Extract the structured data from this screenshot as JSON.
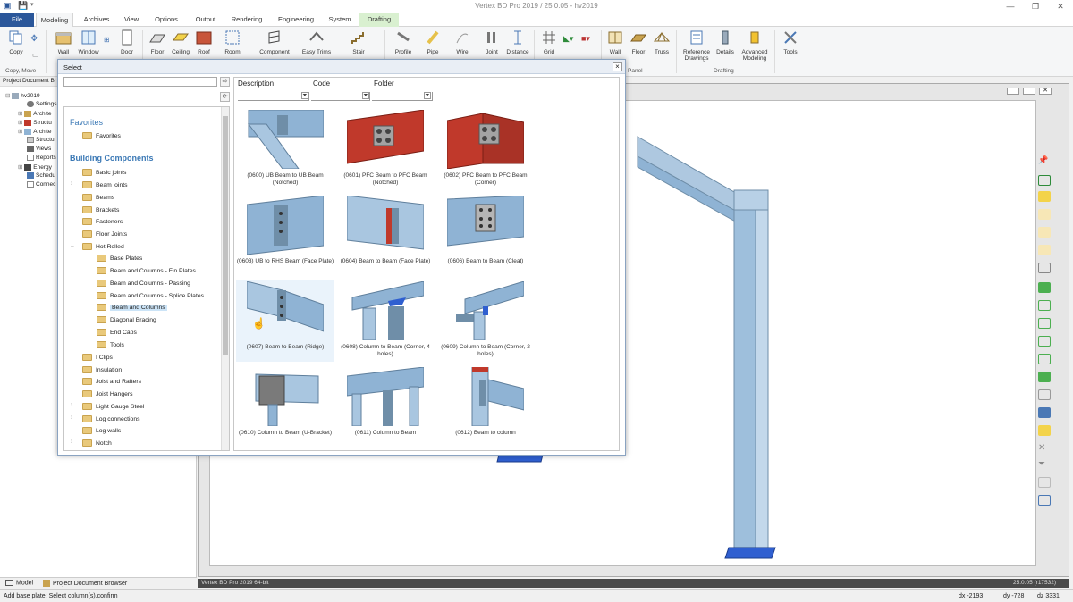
{
  "window": {
    "title": "Vertex BD Pro 2019 / 25.0.05 - hv2019"
  },
  "tabs": [
    {
      "label": "File"
    },
    {
      "label": "Modeling"
    },
    {
      "label": "Archives"
    },
    {
      "label": "View"
    },
    {
      "label": "Options"
    },
    {
      "label": "Output"
    },
    {
      "label": "Rendering"
    },
    {
      "label": "Engineering"
    },
    {
      "label": "System"
    },
    {
      "label": "Drafting"
    }
  ],
  "ribbon": {
    "buttons": [
      {
        "label": "Copy",
        "icon": "copy-icon"
      },
      {
        "label": "Wall",
        "icon": "wall-icon"
      },
      {
        "label": "Window",
        "icon": "window-icon"
      },
      {
        "label": "Door",
        "icon": "door-icon"
      },
      {
        "label": "Floor",
        "icon": "floor-icon"
      },
      {
        "label": "Ceiling",
        "icon": "ceiling-icon"
      },
      {
        "label": "Roof",
        "icon": "roof-icon"
      },
      {
        "label": "Room",
        "icon": "room-icon"
      },
      {
        "label": "Component",
        "icon": "component-icon"
      },
      {
        "label": "Easy Trims",
        "icon": "trim-icon"
      },
      {
        "label": "Stair",
        "icon": "stair-icon"
      },
      {
        "label": "Profile",
        "icon": "profile-icon"
      },
      {
        "label": "Pipe",
        "icon": "pipe-icon"
      },
      {
        "label": "Wire",
        "icon": "wire-icon"
      },
      {
        "label": "Joint",
        "icon": "joint-icon"
      },
      {
        "label": "Distance",
        "icon": "distance-icon"
      },
      {
        "label": "Grid",
        "icon": "grid-icon"
      },
      {
        "label": "Wall",
        "icon": "panel-wall-icon"
      },
      {
        "label": "Floor",
        "icon": "panel-floor-icon"
      },
      {
        "label": "Truss",
        "icon": "truss-icon"
      },
      {
        "label": "Reference Drawings",
        "icon": "reference-icon"
      },
      {
        "label": "Details",
        "icon": "details-icon"
      },
      {
        "label": "Advanced Modeling",
        "icon": "advanced-icon"
      },
      {
        "label": "Tools",
        "icon": "tools-icon"
      }
    ],
    "groups": {
      "copy_move": "Copy, Move",
      "panel": "Panel",
      "drafting": "Drafting"
    }
  },
  "left_panel": {
    "header": "Project Document Br",
    "tree": [
      {
        "label": "hv2019"
      },
      {
        "label": "Settings"
      },
      {
        "label": "Archite"
      },
      {
        "label": "Structu"
      },
      {
        "label": "Archite"
      },
      {
        "label": "Structu"
      },
      {
        "label": "Views"
      },
      {
        "label": "Reports"
      },
      {
        "label": "Energy"
      },
      {
        "label": "Schedu"
      },
      {
        "label": "Connec"
      }
    ],
    "bottom_tabs": [
      "Model",
      "Project Document Browser"
    ]
  },
  "dialog": {
    "title": "Select",
    "sections": {
      "favorites": "Favorites",
      "building_components": "Building Components"
    },
    "folders": [
      {
        "label": "Favorites"
      },
      {
        "label": "Basic joints"
      },
      {
        "label": "Beam joints"
      },
      {
        "label": "Beams"
      },
      {
        "label": "Brackets"
      },
      {
        "label": "Fasteners"
      },
      {
        "label": "Floor Joints"
      },
      {
        "label": "Hot Rolled"
      },
      {
        "label": "Base Plates"
      },
      {
        "label": "Beam and Columns - Fin Plates"
      },
      {
        "label": "Beam and Columns - Passing"
      },
      {
        "label": "Beam and Columns - Splice Plates"
      },
      {
        "label": "Beam and Columns"
      },
      {
        "label": "Diagonal Bracing"
      },
      {
        "label": "End Caps"
      },
      {
        "label": "Tools"
      },
      {
        "label": "I Clips"
      },
      {
        "label": "Insulation"
      },
      {
        "label": "Joist and Rafters"
      },
      {
        "label": "Joist Hangers"
      },
      {
        "label": "Light Gauge Steel"
      },
      {
        "label": "Log connections"
      },
      {
        "label": "Log walls"
      },
      {
        "label": "Notch"
      }
    ],
    "columns": {
      "description": "Description",
      "code": "Code",
      "folder": "Folder"
    },
    "items": [
      {
        "label": "(0600) UB Beam to UB Beam (Notched)"
      },
      {
        "label": "(0601) PFC Beam to PFC Beam (Notched)"
      },
      {
        "label": "(0602) PFC Beam to PFC Beam (Corner)"
      },
      {
        "label": "(0603) UB to RHS Beam (Face Plate)"
      },
      {
        "label": "(0604) Beam to Beam (Face Plate)"
      },
      {
        "label": "(0606) Beam to Beam (Cleat)"
      },
      {
        "label": "(0607) Beam to Beam (Ridge)"
      },
      {
        "label": "(0608) Column to Beam (Corner, 4 holes)"
      },
      {
        "label": "(0609) Column to Beam (Corner, 2 holes)"
      },
      {
        "label": "(0610) Column to Beam (U-Bracket)"
      },
      {
        "label": "(0611) Column to Beam"
      },
      {
        "label": "(0612) Beam to column"
      }
    ]
  },
  "viewport": {
    "status": "Vertex BD Pro  2019  64-bit",
    "version": "25.0.05 (r17532)"
  },
  "statusbar": {
    "prompt": "Add base plate: Select column(s),confirm",
    "dx": "dx -2193",
    "dy": "dy -728",
    "dz": "dz 3331"
  },
  "colors": {
    "file_tab": "#2b579a",
    "drafting_tab": "#d9f0d0",
    "steel": "#8fb3d4",
    "pfc_red": "#c0392b",
    "folder": "#e9c97b"
  }
}
